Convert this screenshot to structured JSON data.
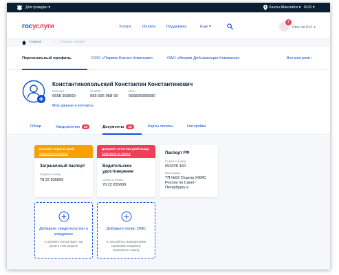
{
  "topbar": {
    "audience": "Для граждан",
    "location": "Ханты-Мансийск",
    "language": "RUS"
  },
  "header": {
    "logo_part1": "гос",
    "logo_part2": "услуги",
    "nav": [
      "Услуги",
      "Оплата",
      "Поддержка",
      "Еще"
    ],
    "notifications_count": "1",
    "user_name": "Иван ов И.И."
  },
  "breadcrumbs": {
    "home": "Главная",
    "current": "Личный кабинет"
  },
  "org_tabs": {
    "items": [
      "Персональный профиль",
      "ООО «Первая Бизнес Компания»",
      "ОАО «Вторая Добывающая Компания»"
    ],
    "all_roles": "Все мои роли"
  },
  "profile": {
    "full_name": "Константинопольский Константин Константинович",
    "passport_label": "Паспорт",
    "passport_value": "6658 369569",
    "snils_label": "СНИЛС",
    "snils_value": "685 596 958 99",
    "inn_label": "ИНН",
    "inn_value": "665896958990",
    "my_data_link": "Мои данные и контакты"
  },
  "section_tabs": {
    "overview": "Обзор",
    "notifications": "Уведомления",
    "notifications_count": "28",
    "documents": "Документы",
    "documents_count": "28",
    "payment_cards": "Карты оплаты",
    "settings": "Настройки"
  },
  "documents": {
    "foreign_passport": {
      "banner_title": "Истекает через 14 дней",
      "banner_link": "Заявление на замену",
      "title": "Заграничный паспорт",
      "label": "Серия и номер",
      "value": "78 22 835899"
    },
    "driver_license": {
      "banner_title": "Документ истек 625 дней назад",
      "banner_link": "Заявление на замену",
      "title": "Водительское удостоверение",
      "label": "Серия и номер",
      "value": "78 22 835899"
    },
    "rf_passport": {
      "title": "Паспорт РФ",
      "series_label": "Серия и номер",
      "series_value": "6520УК 160",
      "issued_label": "Кем выдан",
      "issued_value": "ТП №52 Отдела УФМС России по Санкт-Петербургу и"
    }
  },
  "add_cards": {
    "birth_certificate": {
      "title": "Добавьте свидетельство о рождении",
      "desc": "и документ всегда будет под рукой в этом разделе"
    },
    "oms": {
      "title": "Добавьте полис ОМС",
      "desc": "и пользуйтесь медицинскими сервисами, например, запишитесь к врачу"
    }
  },
  "colors": {
    "brand_blue": "#0d4cd3",
    "brand_red": "#ee3f58",
    "warning_orange": "#f7a100",
    "dark": "#0b1f33"
  }
}
